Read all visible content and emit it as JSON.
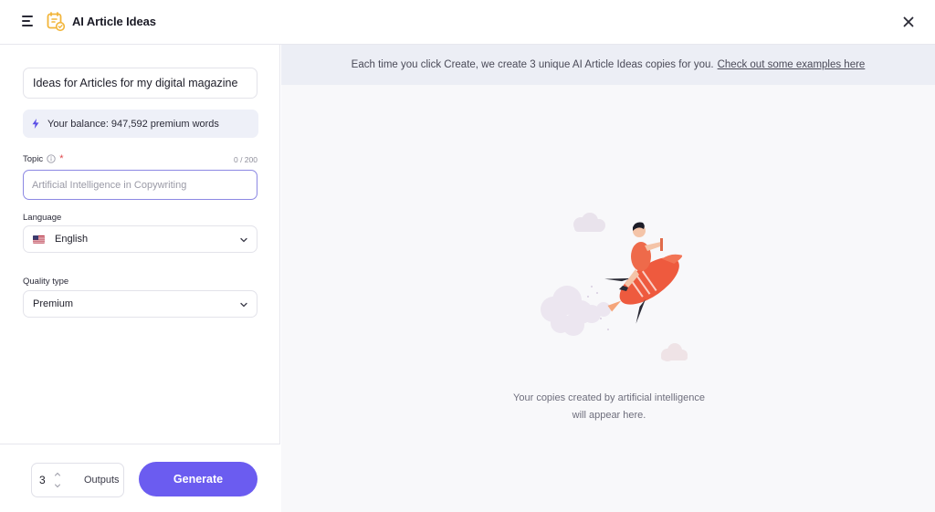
{
  "header": {
    "menu_icon": "hamburger-menu-icon",
    "logo_icon": "ai-article-logo-icon",
    "title": "AI Article Ideas",
    "close_icon": "close-icon"
  },
  "form": {
    "title_value": "Ideas for Articles for my digital magazine",
    "balance_icon": "lightning-icon",
    "balance_text": "Your balance: 947,592 premium words",
    "topic": {
      "label": "Topic",
      "required_mark": "*",
      "counter": "0 / 200",
      "value": "",
      "placeholder": "Artificial Intelligence in Copywriting"
    },
    "language": {
      "label": "Language",
      "selected": "English",
      "flag_icon": "us-flag-icon"
    },
    "quality": {
      "label": "Quality type",
      "selected": "Premium"
    }
  },
  "footer": {
    "outputs_value": "3",
    "outputs_label": "Outputs",
    "generate_label": "Generate"
  },
  "results": {
    "info_text": "Each time you click Create, we create 3 unique AI Article Ideas copies for you.",
    "info_link": "Check out some examples here",
    "empty_line1": "Your copies created by artificial intelligence",
    "empty_line2": "will appear here.",
    "illustration_icon": "person-on-rocket-illustration"
  },
  "colors": {
    "accent": "#6b5cf0",
    "input_focus_border": "#8c88e3",
    "balance_bg": "#eef0f8",
    "info_bar_bg": "#eceef5",
    "required": "#e0474c"
  }
}
